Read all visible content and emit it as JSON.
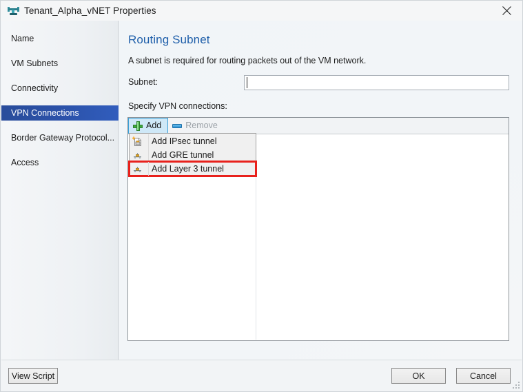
{
  "window": {
    "title": "Tenant_Alpha_vNET Properties",
    "icon": "network-switch-icon",
    "close_label": "close-icon"
  },
  "sidebar": {
    "items": [
      {
        "label": "Name",
        "selected": false
      },
      {
        "label": "VM Subnets",
        "selected": false
      },
      {
        "label": "Connectivity",
        "selected": false
      },
      {
        "label": "VPN Connections",
        "selected": true
      },
      {
        "label": "Border Gateway Protocol...",
        "selected": false
      },
      {
        "label": "Access",
        "selected": false
      }
    ]
  },
  "main": {
    "title": "Routing Subnet",
    "description": "A subnet is required for routing packets out of the VM network.",
    "subnet": {
      "label": "Subnet:",
      "value": "",
      "placeholder": ""
    },
    "specify_label": "Specify VPN connections:",
    "toolbar": {
      "add_label": "Add",
      "remove_label": "Remove",
      "add_icon": "plus-icon",
      "remove_icon": "minus-icon"
    },
    "menu": {
      "items": [
        {
          "label": "Add IPsec tunnel",
          "icon": "new-document-icon",
          "highlighted": false
        },
        {
          "label": "Add GRE tunnel",
          "icon": "gateway-icon",
          "highlighted": false
        },
        {
          "label": "Add Layer 3 tunnel",
          "icon": "gateway-icon",
          "highlighted": true
        }
      ],
      "highlight_color": "#e8211c"
    }
  },
  "footer": {
    "view_script_label": "View Script",
    "ok_label": "OK",
    "cancel_label": "Cancel"
  },
  "colors": {
    "accent": "#1f5faa",
    "selected_nav": "#2b51a8",
    "highlight": "#e8211c"
  }
}
